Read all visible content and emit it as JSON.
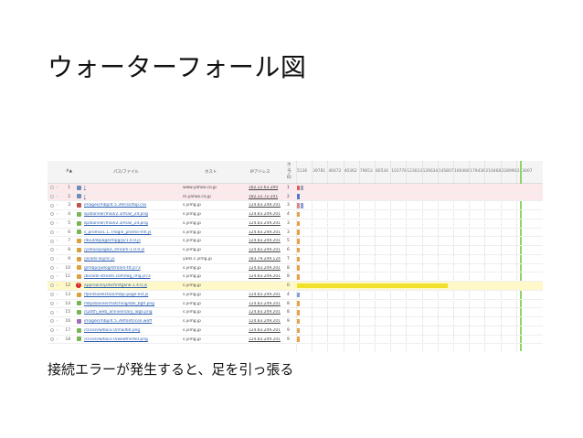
{
  "slide": {
    "title": "ウォーターフォール図",
    "caption": "接続エラーが発生すると、足を引っ張る"
  },
  "table": {
    "columns": {
      "num": "#▲",
      "path": "パス/ファイル",
      "host": "ホスト",
      "ip": "IPアドレス",
      "hop": "ホップID"
    },
    "timeline_ticks": [
      "5136",
      "39781",
      "46472",
      "40362",
      "79653",
      "80534",
      "103778",
      "123013",
      "126634",
      "145807",
      "166466",
      "179436",
      "210468",
      "228990",
      "243007"
    ],
    "highlight_color": "#f2e12a",
    "rows": [
      {
        "n": "1",
        "icon": "globe-icon",
        "path": "/",
        "host": "www.yahoo.co.jp",
        "ip": "182.22.63.200",
        "hop": "1",
        "style": "pink",
        "bars": [
          {
            "color": "#e05a5a"
          },
          {
            "color": "#9aa7b8"
          }
        ]
      },
      {
        "n": "2",
        "icon": "globe-icon",
        "path": "/",
        "host": "m.yahoo.co.jp",
        "ip": "182.22.72.241",
        "hop": "2",
        "style": "pink",
        "bars": [
          {
            "color": "#4a7bd0"
          }
        ]
      },
      {
        "n": "3",
        "icon": "css-icon",
        "path": "images/mbp/4.5.39/css/top.css",
        "host": "s.yimg.jp",
        "ip": "124.83.249.201",
        "hop": "3",
        "style": "",
        "bars": [
          {
            "color": "#d88"
          },
          {
            "color": "#8a9fd6"
          }
        ]
      },
      {
        "n": "4",
        "icon": "image-icon",
        "path": "sp/banner/mail/2.3/mail_24.png",
        "host": "s.yimg.jp",
        "ip": "124.83.249.201",
        "hop": "4",
        "style": "",
        "bars": [
          {
            "color": "#e8a04a"
          }
        ]
      },
      {
        "n": "5",
        "icon": "image-icon",
        "path": "sp/banner/mail/2.3/mail_24.png",
        "host": "s.yimg.jp",
        "ip": "124.83.249.201",
        "hop": "3",
        "style": "",
        "bars": [
          {
            "color": "#e8a04a"
          }
        ]
      },
      {
        "n": "6",
        "icon": "image-icon",
        "path": "s_promo/1.1.7/login_promo-mh.js",
        "host": "s.yimg.jp",
        "ip": "124.83.249.201",
        "hop": "3",
        "style": "",
        "bars": [
          {
            "color": "#e8a04a"
          }
        ]
      },
      {
        "n": "7",
        "icon": "js-icon",
        "path": "/dout/ibpage/mpg/js/1.0.0.js",
        "host": "s.yimg.jp",
        "ip": "124.83.249.201",
        "hop": "5",
        "style": "",
        "bars": [
          {
            "color": "#e8a04a"
          }
        ]
      },
      {
        "n": "8",
        "icon": "js-icon",
        "path": "/yahoo/pagejs_stream-1.0.0.js",
        "host": "s.yimg.jp",
        "ip": "124.83.249.201",
        "hop": "6",
        "style": "",
        "bars": [
          {
            "color": "#e8a04a"
          }
        ]
      },
      {
        "n": "9",
        "icon": "js-icon",
        "path": "/js/ads-async.js",
        "host": "yads.c.yimg.jp",
        "ip": "183.79.249.124",
        "hop": "7",
        "style": "",
        "bars": [
          {
            "color": "#e8a04a"
          }
        ]
      },
      {
        "n": "10",
        "icon": "js-icon",
        "path": "g/mbp/ywlog/stream-tlt.js?3",
        "host": "s.yimg.jp",
        "ip": "124.83.249.201",
        "hop": "8",
        "style": "",
        "bars": [
          {
            "color": "#e8a04a"
          }
        ]
      },
      {
        "n": "11",
        "icon": "js-icon",
        "path": "/bo/ads-stream.com/log_img.js?3",
        "host": "s.yimg.jp",
        "ip": "124.83.249.201",
        "hop": "8",
        "style": "",
        "bars": [
          {
            "color": "#e8a04a"
          }
        ]
      },
      {
        "n": "12",
        "icon": "error-icon",
        "path": "approach/js/bcfirstglink-1.4.0.js",
        "host": "s.yimg.jp",
        "ip": "",
        "hop": "0",
        "style": "yellow",
        "bars": [
          {
            "color": "#f2e12a",
            "level": 0.61
          }
        ]
      },
      {
        "n": "13",
        "icon": "js-icon",
        "path": "/fjontsselection/mbp-page-list.js",
        "host": "s.yimg.jp",
        "ip": "124.83.249.201",
        "hop": "4",
        "style": "",
        "bars": [
          {
            "color": "#8a9fd6"
          }
        ]
      },
      {
        "n": "14",
        "icon": "image-icon",
        "path": "mbp/banner/hatching/sbk_bgfl.png",
        "host": "s.yimg.jp",
        "ip": "124.83.249.201",
        "hop": "8",
        "style": "",
        "bars": [
          {
            "color": "#e8a04a"
          }
        ]
      },
      {
        "n": "15",
        "icon": "image-icon",
        "path": "/s20th_web_anniversary_logo.png",
        "host": "s.yimg.jp",
        "ip": "124.83.249.201",
        "hop": "8",
        "style": "",
        "bars": [
          {
            "color": "#e8a04a"
          }
        ]
      },
      {
        "n": "16",
        "icon": "font-icon",
        "path": "images/mbp/4.5.39/font/icon.woff",
        "host": "s.yimg.jp",
        "ip": "124.83.249.201",
        "hop": "9",
        "style": "",
        "bars": [
          {
            "color": "#e8a04a"
          }
        ]
      },
      {
        "n": "17",
        "icon": "image-icon",
        "path": "/c/icon/w/bo/2.0/mail60.png",
        "host": "s.yimg.jp",
        "ip": "124.83.249.201",
        "hop": "9",
        "style": "",
        "bars": [
          {
            "color": "#e8a04a"
          }
        ]
      },
      {
        "n": "18",
        "icon": "image-icon",
        "path": "/c/icon/w/bo/2.0/weather60.png",
        "host": "s.yimg.jp",
        "ip": "124.83.249.201",
        "hop": "9",
        "style": "",
        "bars": [
          {
            "color": "#e8a04a"
          }
        ]
      }
    ]
  }
}
